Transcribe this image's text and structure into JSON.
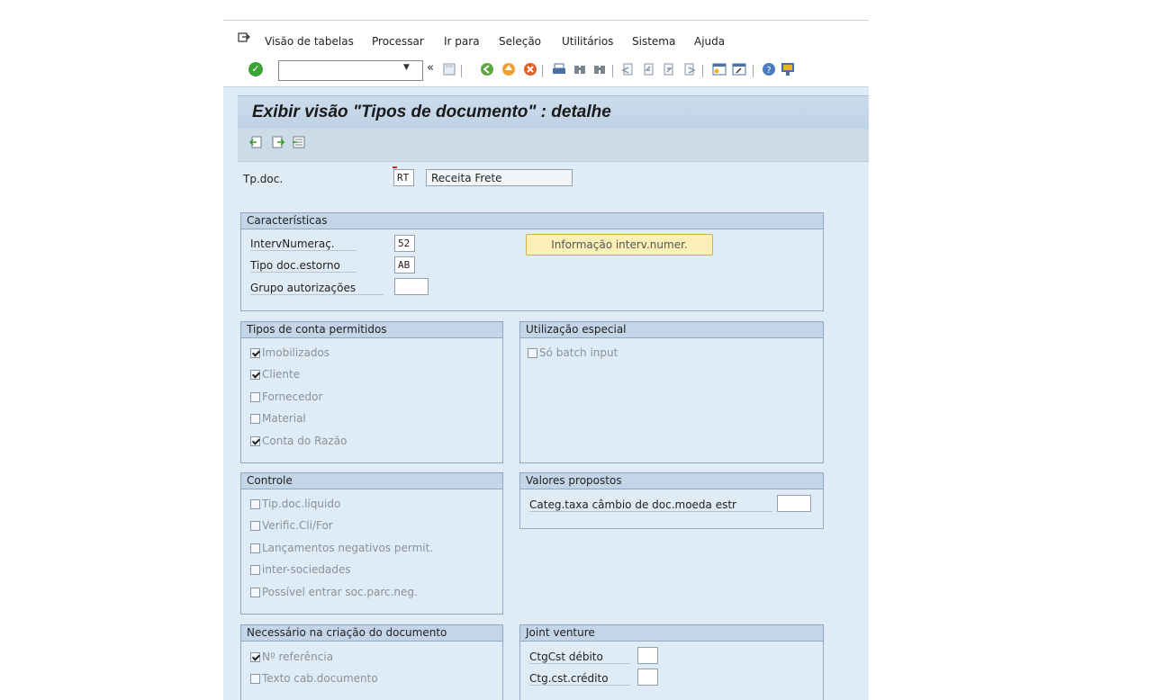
{
  "menubar": {
    "items": [
      "Visão de tabelas",
      "Processar",
      "Ir para",
      "Seleção",
      "Utilitários",
      "Sistema",
      "Ajuda"
    ],
    "exit_icon": "exit-icon"
  },
  "toolbar": {
    "command_field_value": "",
    "ok_icon": "check-icon",
    "buttons": [
      "back-nav-icon",
      "save-icon",
      "back-icon",
      "exit-icon",
      "cancel-icon",
      "print-icon",
      "find-icon",
      "find-next-icon",
      "first-page-icon",
      "previous-page-icon",
      "next-page-icon",
      "last-page-icon",
      "create-session-icon",
      "shortcut-icon",
      "help-icon",
      "layout-menu-icon"
    ]
  },
  "page_title": "Exibir visão \"Tipos de documento\" : detalhe",
  "app_toolbar": {
    "icons": [
      "previous-entry-icon",
      "next-entry-icon",
      "other-entry-icon"
    ]
  },
  "header": {
    "doc_type_label": "Tp.doc.",
    "doc_type_value": "RT",
    "doc_type_desc": "Receita Frete"
  },
  "caracteristicas": {
    "title": "Características",
    "interv_label": "IntervNumeraç.",
    "interv_value": "52",
    "estorno_label": "Tipo doc.estorno",
    "estorno_value": "AB",
    "grupo_label": "Grupo autorizações",
    "grupo_value": "",
    "info_button": "Informação interv.numer."
  },
  "tipos_conta": {
    "title": "Tipos de conta permitidos",
    "items": [
      {
        "label": "Imobilizados",
        "checked": true
      },
      {
        "label": "Cliente",
        "checked": true
      },
      {
        "label": "Fornecedor",
        "checked": false
      },
      {
        "label": "Material",
        "checked": false
      },
      {
        "label": "Conta do Razão",
        "checked": true
      }
    ]
  },
  "utilizacao": {
    "title": "Utilização especial",
    "items": [
      {
        "label": "Só batch input",
        "checked": false
      }
    ]
  },
  "controle": {
    "title": "Controle",
    "items": [
      {
        "label": "Tip.doc.líquido",
        "checked": false
      },
      {
        "label": "Verific.Cli/For",
        "checked": false
      },
      {
        "label": "Lançamentos negativos permit.",
        "checked": false
      },
      {
        "label": "inter-sociedades",
        "checked": false
      },
      {
        "label": "Possível entrar soc.parc.neg.",
        "checked": false
      }
    ]
  },
  "valores": {
    "title": "Valores propostos",
    "categ_label": "Categ.taxa câmbio de doc.moeda estr",
    "categ_value": ""
  },
  "necessario": {
    "title": "Necessário na criação do documento",
    "items": [
      {
        "label": "Nº referência",
        "checked": true
      },
      {
        "label": "Texto cab.documento",
        "checked": false
      }
    ]
  },
  "joint": {
    "title": "Joint venture",
    "debito_label": "CtgCst débito",
    "debito_value": "",
    "credito_label": "Ctg.cst.crédito",
    "credito_value": ""
  }
}
